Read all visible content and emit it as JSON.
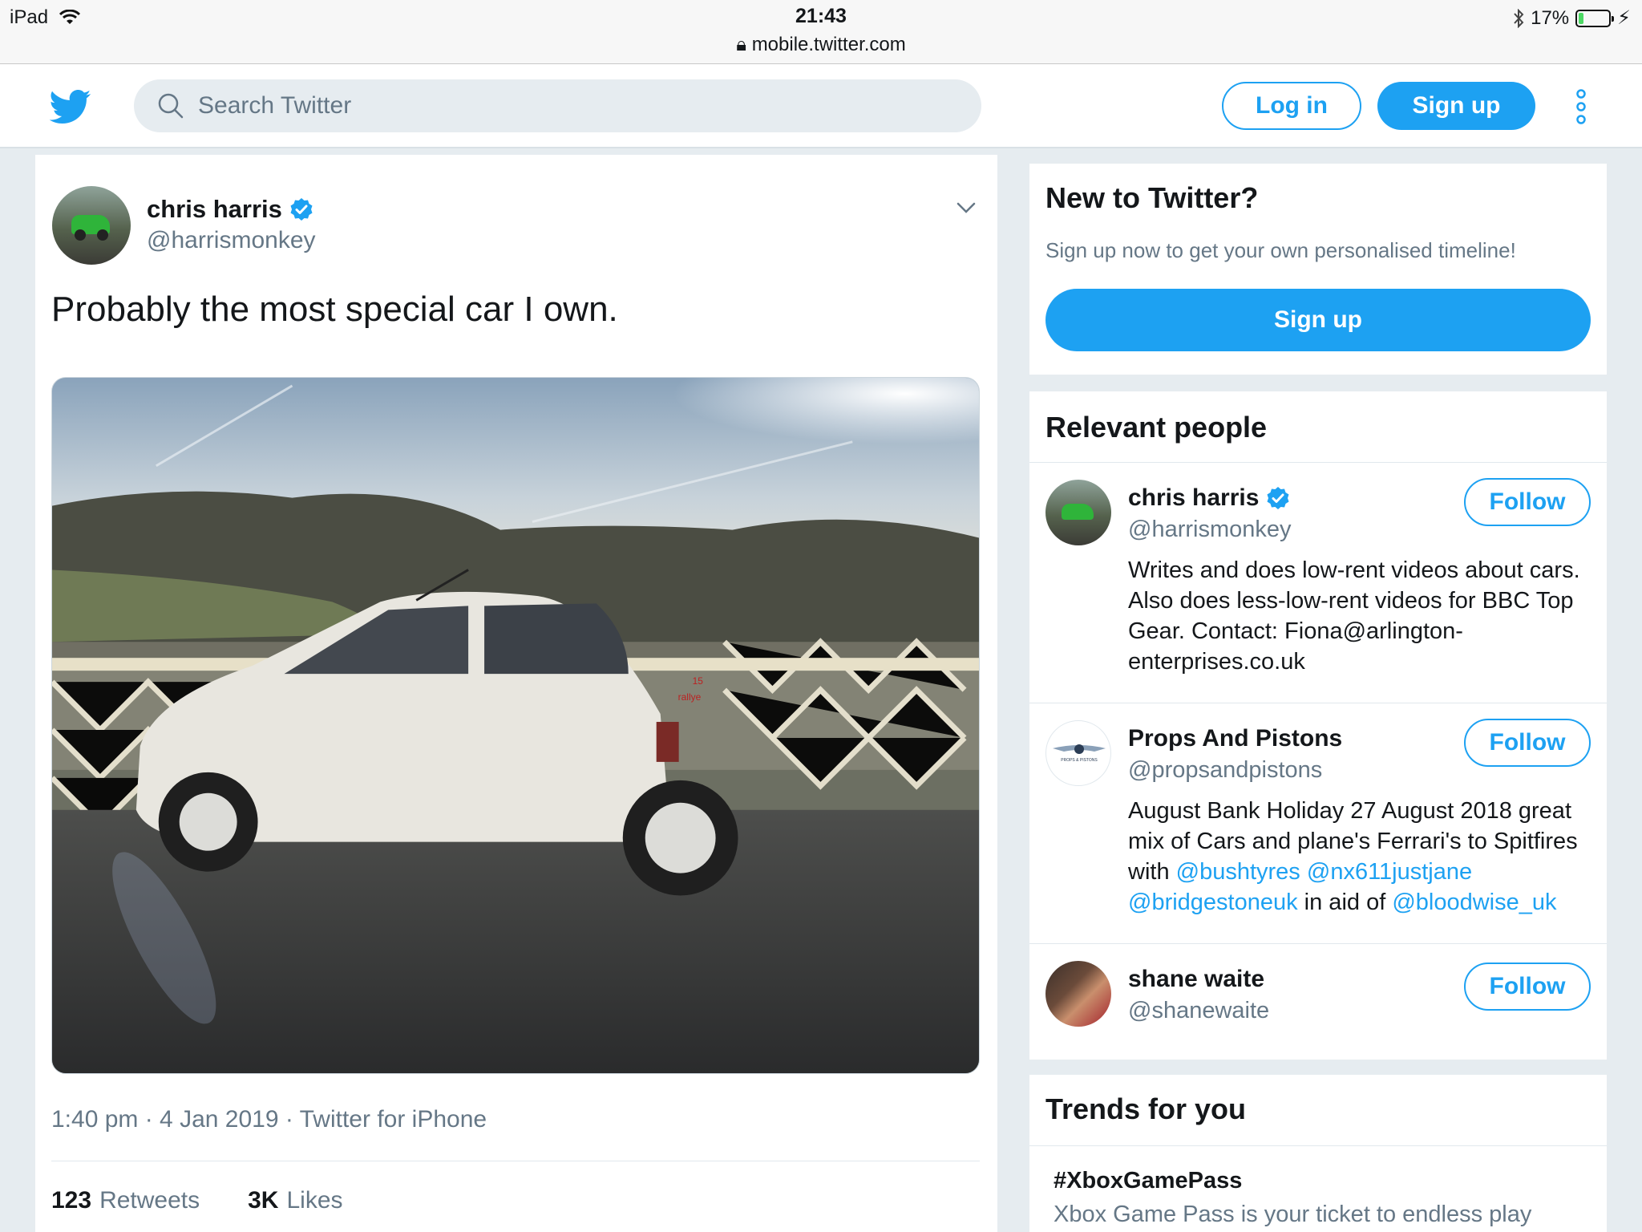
{
  "status_bar": {
    "device": "iPad",
    "time": "21:43",
    "url": "mobile.twitter.com",
    "battery": "17%",
    "battery_level": 0.17
  },
  "header": {
    "search_placeholder": "Search Twitter",
    "login_label": "Log in",
    "signup_label": "Sign up",
    "brand_color": "#1da1f2"
  },
  "tweet": {
    "author_name": "chris harris",
    "author_handle": "@harrismonkey",
    "text": "Probably the most special car I own.",
    "timestamp": "1:40 pm · 4 Jan 2019 · Twitter for iPhone",
    "retweets_count": "123",
    "retweets_label": "Retweets",
    "likes_count": "3K",
    "likes_label": "Likes",
    "car_badge_top": "15",
    "car_badge_bottom": "rallye"
  },
  "sidebar": {
    "new_to_twitter": {
      "title": "New to Twitter?",
      "subtitle": "Sign up now to get your own personalised timeline!",
      "signup_label": "Sign up"
    },
    "relevant_people": {
      "title": "Relevant people",
      "people": [
        {
          "name": "chris harris",
          "handle": "@harrismonkey",
          "verified": true,
          "bio": "Writes and does low-rent videos about cars. Also does less-low-rent videos for BBC Top Gear. Contact: Fiona@arlington-enterprises.co.uk",
          "follow_label": "Follow"
        },
        {
          "name": "Props And Pistons",
          "handle": "@propsandpistons",
          "verified": false,
          "bio_prefix": "August Bank Holiday 27 August 2018 great mix of Cars and plane's Ferrari's to Spitfires with ",
          "mention1": "@bushtyres",
          "mention2": "@nx611justjane",
          "mention3": "@bridgestoneuk",
          "bio_mid": " in aid of ",
          "mention4": "@bloodwise_uk",
          "logo_text": "PROPS & PISTONS",
          "follow_label": "Follow"
        },
        {
          "name": "shane waite",
          "handle": "@shanewaite",
          "verified": false,
          "follow_label": "Follow"
        }
      ]
    },
    "trends": {
      "title": "Trends for you",
      "items": [
        {
          "name": "#XboxGamePass",
          "description": "Xbox Game Pass is your ticket to endless play"
        }
      ]
    }
  }
}
